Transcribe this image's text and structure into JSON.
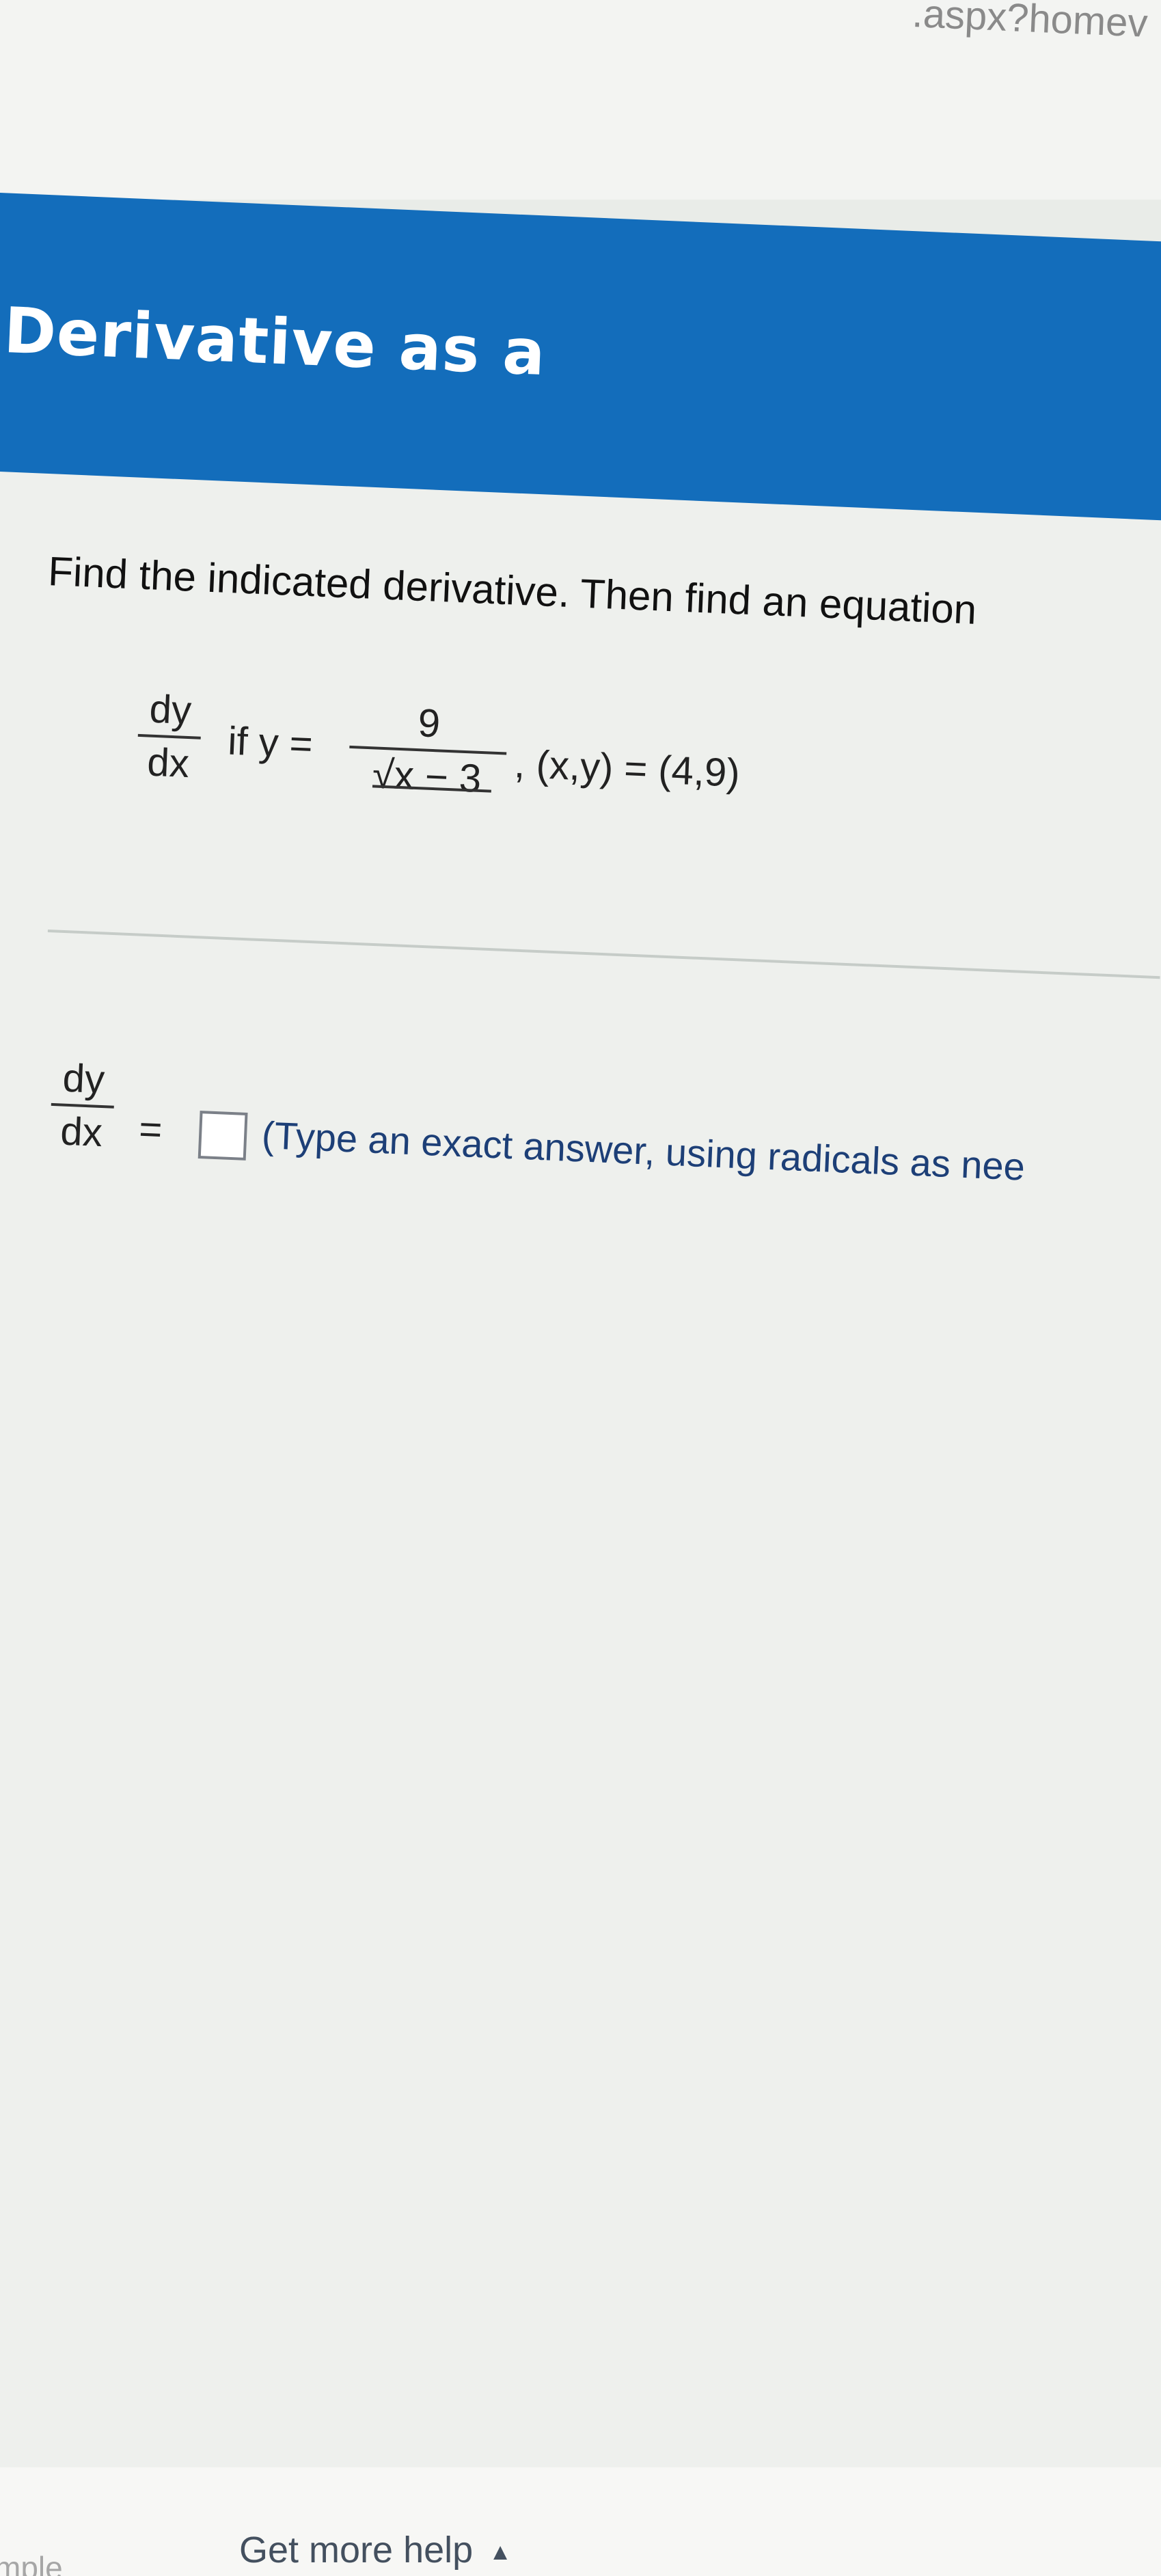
{
  "browser": {
    "address_fragment": ".aspx?homev"
  },
  "header": {
    "title": "Derivative as a"
  },
  "problem": {
    "prompt": "Find the indicated derivative. Then find an equation",
    "derivative_label": {
      "numerator": "dy",
      "denominator": "dx"
    },
    "equation": {
      "if_text": "if y =",
      "numerator": "9",
      "radical_content": "x − 3",
      "point_text": ", (x,y) = (4,9)"
    }
  },
  "answer": {
    "derivative_label": {
      "numerator": "dy",
      "denominator": "dx"
    },
    "equals": "=",
    "input_value": "",
    "instruction": "(Type an exact answer, using radicals as nee"
  },
  "footer": {
    "left_fragment": "mple",
    "help_label": "Get more help",
    "help_caret": "▲"
  },
  "colors": {
    "header_band": "#136dbb",
    "instruction_text": "#1d3f77",
    "input_border": "#7b8088"
  }
}
